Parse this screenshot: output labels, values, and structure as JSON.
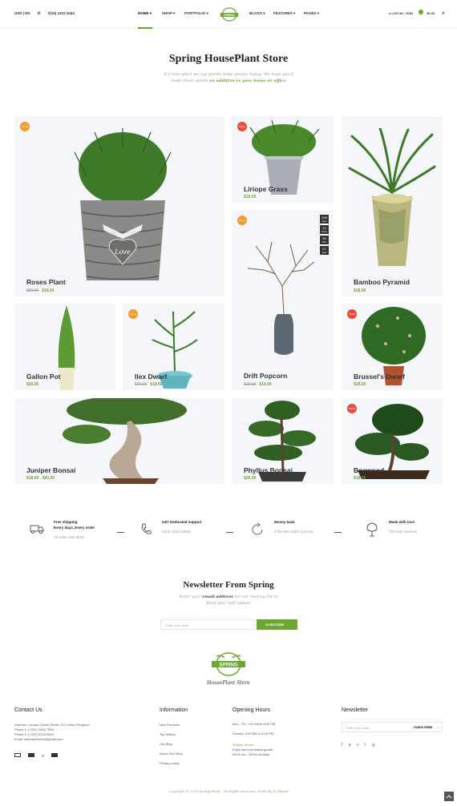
{
  "header": {
    "currency": "USD | EN",
    "phone": "0(34) 2322 3444",
    "nav": [
      "HOME",
      "SHOP",
      "PORTFOLIO",
      "BLOGS",
      "FEATURES",
      "PAGES"
    ],
    "login": "LOG IN / JOIN",
    "cart_total": "$0.00",
    "cart_count": "0"
  },
  "hero": {
    "title": "Spring HousePlant Store",
    "sub1": "It's true when we say plants make people happy. We hope you'll",
    "sub2": "make these plants",
    "sub_emph": "an addition to your home or office"
  },
  "products": [
    {
      "name": "Roses Plant",
      "old": "$20.00",
      "price": "$18.00",
      "badge": "SALE"
    },
    {
      "name": "Liriope Grass",
      "price": "$19.00",
      "badge": "SALE"
    },
    {
      "name": "Bamboo Pyramid",
      "price": "$18.00"
    },
    {
      "name": "Drift Popcorn",
      "old": "$18.00",
      "price": "$16.00",
      "badge": "SALE"
    },
    {
      "name": "Gallon Pot",
      "price": "$20.00"
    },
    {
      "name": "Ilex Dwarf",
      "old": "$20.00",
      "price": "$18.00",
      "badge": "SALE"
    },
    {
      "name": "Brussel's Dwarf",
      "price": "$18.00",
      "badge": "SALE"
    },
    {
      "name": "Juniper Bonsai",
      "price": "$18.00 - $20.00"
    },
    {
      "name": "Phyllus Bonsai",
      "price": "$20.00"
    },
    {
      "name": "Boxwood",
      "price": "$18.00",
      "badge": "SALE"
    }
  ],
  "countdown": [
    {
      "v": "239",
      "l": "Days"
    },
    {
      "v": "12",
      "l": "Hours"
    },
    {
      "v": "49",
      "l": "Mins"
    },
    {
      "v": "07",
      "l": "Secs"
    }
  ],
  "features": [
    {
      "title": "Free shipping",
      "title2": "Every days, Every order",
      "desc": "All order over $100",
      "icon": "truck-icon"
    },
    {
      "title": "24/7 Dedicated support",
      "desc": "0(34) 4234 54666",
      "icon": "phone-icon"
    },
    {
      "title": "Money back",
      "desc": "If the item didn't suit you",
      "icon": "refresh-icon"
    },
    {
      "title": "Made with love",
      "desc": "The best services",
      "icon": "tree-icon"
    }
  ],
  "newsletter": {
    "title": "Newsletter From Spring",
    "sub1": "Enter your",
    "sub_emph": "email address",
    "sub2": "for our mailing list to",
    "sub3": "keep your self update",
    "placeholder": "Enter your email",
    "button": "SUBSCRIBE"
  },
  "footer": {
    "tagline": "HousePlant Store",
    "contact": {
      "title": "Contact Us",
      "lines": [
        "Address: London Oxford Street, 012 United Kingdom.",
        "Phone 1: (+032) 3456 7890",
        "Phone 2: (+032) 3123 5544",
        "Email: salemaxtheme@gmail.com"
      ]
    },
    "info": {
      "title": "Information",
      "links": [
        "New Products",
        "Top Sellers",
        "Our Blog",
        "About Our Shop",
        "Privacy policy"
      ]
    },
    "hours": {
      "title": "Opening Hours",
      "lines": [
        "Mon - Fri: 7:00 AM to 8:00 PM",
        "Sunday: 8:00 AM to 5:00 PM"
      ],
      "happy": "Happy Hours",
      "happy_lines": [
        "Enjoy discount baked goods.",
        "04:00 am - 08:00 pm daily"
      ]
    },
    "news": {
      "title": "Newsletter",
      "placeholder": "Enter your email",
      "button": "SUBSCRIBE"
    },
    "copyright": "Copyright © 2018",
    "copy_brand": "Spring Store",
    "copy_rest": " – All Rights Reserved. Made By",
    "copy_author": "Lt-Theme"
  },
  "colors": {
    "accent": "#6aa82f",
    "sale": "#f39c30",
    "sale_red": "#e74c3c",
    "card_bg": "#f5f6fa"
  }
}
